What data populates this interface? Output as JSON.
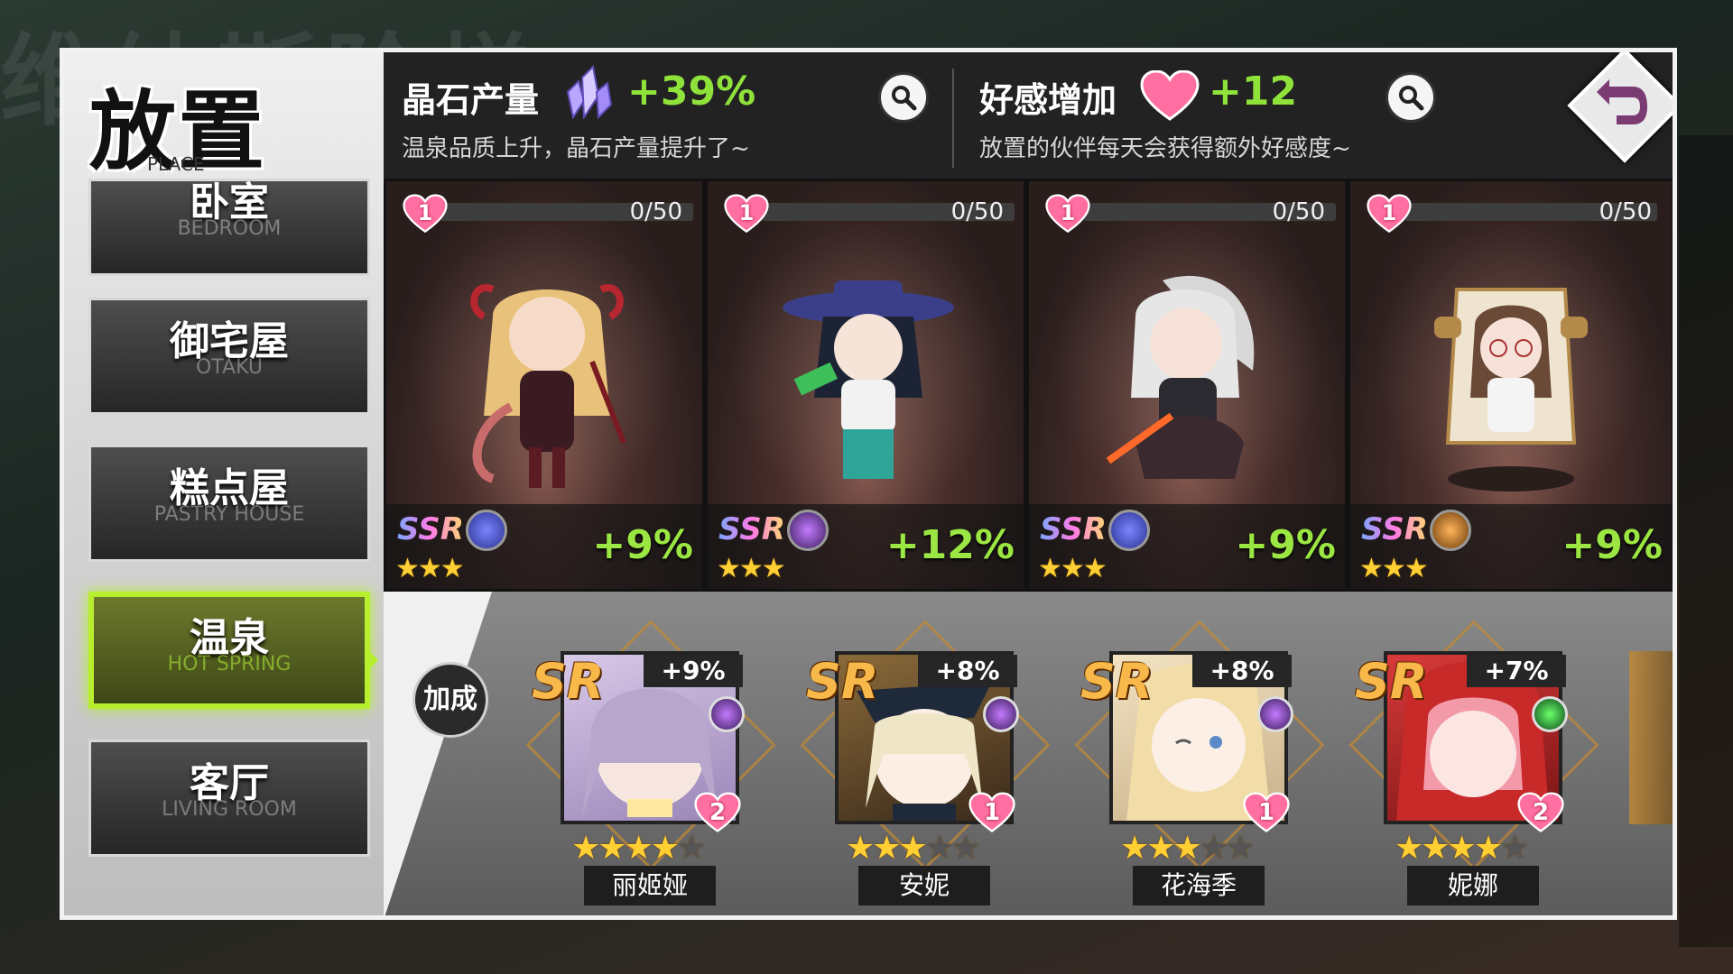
{
  "background": {
    "watermark": "维纳斯阶梯"
  },
  "left_panel": {
    "title": "放置",
    "title_en": "PLACE",
    "rooms": [
      {
        "label": "卧室",
        "label_en": "BEDROOM",
        "active": false
      },
      {
        "label": "御宅屋",
        "label_en": "OTAKU",
        "active": false
      },
      {
        "label": "糕点屋",
        "label_en": "PASTRY HOUSE",
        "active": false
      },
      {
        "label": "温泉",
        "label_en": "HOT SPRING",
        "active": true
      },
      {
        "label": "客厅",
        "label_en": "LIVING ROOM",
        "active": false
      }
    ]
  },
  "header": {
    "crystal": {
      "title": "晶石产量",
      "value": "+39%",
      "desc": "温泉品质上升，晶石产量提升了~",
      "icon": "crystal-icon"
    },
    "affection": {
      "title": "好感增加",
      "value": "+12",
      "desc": "放置的伙伴每天会获得额外好感度~",
      "icon": "heart-icon"
    },
    "back_icon": "undo-arrow-icon"
  },
  "placed_characters": [
    {
      "affection_level": "1",
      "progress": "0/50",
      "progress_fraction": 0,
      "rarity": "SSR",
      "stars": "★★★",
      "bonus": "+9%",
      "element": "clover",
      "element_color": "#5d6de0"
    },
    {
      "affection_level": "1",
      "progress": "0/50",
      "progress_fraction": 0,
      "rarity": "SSR",
      "stars": "★★★",
      "bonus": "+12%",
      "element": "dark",
      "element_color": "#a24be0"
    },
    {
      "affection_level": "1",
      "progress": "0/50",
      "progress_fraction": 0,
      "rarity": "SSR",
      "stars": "★★★",
      "bonus": "+9%",
      "element": "clover",
      "element_color": "#5d6de0"
    },
    {
      "affection_level": "1",
      "progress": "0/50",
      "progress_fraction": 0,
      "rarity": "SSR",
      "stars": "★★★",
      "bonus": "+9%",
      "element": "fire",
      "element_color": "#e08a2a"
    }
  ],
  "bonus_section": {
    "button_label": "加成",
    "characters": [
      {
        "rarity": "SR",
        "bonus": "+9%",
        "affection": "2",
        "stars_on": "★★★★",
        "stars_off": "★",
        "name": "丽姬娅",
        "element_color": "#a24be0"
      },
      {
        "rarity": "SR",
        "bonus": "+8%",
        "affection": "1",
        "stars_on": "★★★",
        "stars_off": "★★",
        "name": "安妮",
        "element_color": "#a24be0"
      },
      {
        "rarity": "SR",
        "bonus": "+8%",
        "affection": "1",
        "stars_on": "★★★",
        "stars_off": "★★",
        "name": "花海季",
        "element_color": "#a24be0"
      },
      {
        "rarity": "SR",
        "bonus": "+7%",
        "affection": "2",
        "stars_on": "★★★★",
        "stars_off": "★",
        "name": "妮娜",
        "element_color": "#3fbf3f"
      }
    ]
  }
}
